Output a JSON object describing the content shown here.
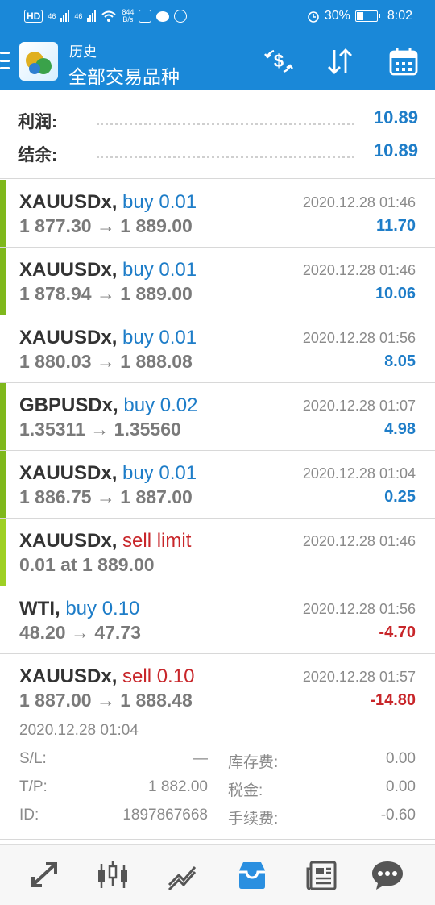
{
  "status_bar": {
    "speed": "844",
    "speed_unit": "B/s",
    "net1": "46",
    "net2": "46",
    "battery": "30%",
    "time": "8:02"
  },
  "header": {
    "subtitle": "历史",
    "title": "全部交易品种",
    "icons": [
      "menu-icon",
      "currency-exchange-icon",
      "sort-icon",
      "calendar-icon"
    ]
  },
  "summary": {
    "profit_label": "利润:",
    "profit_value": "10.89",
    "balance_label": "结余:",
    "balance_value": "10.89"
  },
  "trades": [
    {
      "symbol": "XAUUSDx,",
      "side": "buy 0.01",
      "side_type": "buy",
      "prices": "1 877.30 → 1 889.00",
      "time": "2020.12.28 01:46",
      "profit": "11.70",
      "profit_sign": "pos"
    },
    {
      "symbol": "XAUUSDx,",
      "side": "buy 0.01",
      "side_type": "buy",
      "prices": "1 878.94 → 1 889.00",
      "time": "2020.12.28 01:46",
      "profit": "10.06",
      "profit_sign": "pos"
    },
    {
      "symbol": "XAUUSDx,",
      "side": "buy 0.01",
      "side_type": "buy",
      "prices": "1 880.03 → 1 888.08",
      "time": "2020.12.28 01:56",
      "profit": "8.05",
      "profit_sign": "pos"
    },
    {
      "symbol": "GBPUSDx,",
      "side": "buy 0.02",
      "side_type": "buy",
      "prices": "1.35311 → 1.35560",
      "time": "2020.12.28 01:07",
      "profit": "4.98",
      "profit_sign": "pos"
    },
    {
      "symbol": "XAUUSDx,",
      "side": "buy 0.01",
      "side_type": "buy",
      "prices": "1 886.75 → 1 887.00",
      "time": "2020.12.28 01:04",
      "profit": "0.25",
      "profit_sign": "pos"
    },
    {
      "symbol": "XAUUSDx,",
      "side": "sell limit",
      "side_type": "sell",
      "prices": "0.01 at 1 889.00",
      "time": "2020.12.28 01:46",
      "profit": "",
      "profit_sign": "pos"
    },
    {
      "symbol": "WTI,",
      "side": "buy 0.10",
      "side_type": "buy",
      "prices": "48.20 → 47.73",
      "time": "2020.12.28 01:56",
      "profit": "-4.70",
      "profit_sign": "neg"
    },
    {
      "symbol": "XAUUSDx,",
      "side": "sell 0.10",
      "side_type": "sell",
      "prices": "1 887.00 → 1 888.48",
      "time": "2020.12.28 01:57",
      "profit": "-14.80",
      "profit_sign": "neg"
    }
  ],
  "expanded": {
    "open_time": "2020.12.28 01:04",
    "sl_label": "S/L:",
    "sl_value": "—",
    "tp_label": "T/P:",
    "tp_value": "1 882.00",
    "id_label": "ID:",
    "id_value": "1897867668",
    "swap_label": "库存费:",
    "swap_value": "0.00",
    "tax_label": "税金:",
    "tax_value": "0.00",
    "commission_label": "手续费:",
    "commission_value": "-0.60"
  },
  "tabs": [
    {
      "name": "tab-trade",
      "icon": "trade-arrows-icon",
      "active": false
    },
    {
      "name": "tab-chart",
      "icon": "candlestick-icon",
      "active": false
    },
    {
      "name": "tab-quotes",
      "icon": "trend-icon",
      "active": false
    },
    {
      "name": "tab-history",
      "icon": "inbox-icon",
      "active": true
    },
    {
      "name": "tab-news",
      "icon": "newspaper-icon",
      "active": false
    },
    {
      "name": "tab-chat",
      "icon": "chat-icon",
      "active": false
    }
  ],
  "colors": {
    "header_bg": "#1a88d8",
    "buy": "#1e7dc8",
    "sell": "#c8262a",
    "profit_pos": "#1e7dc8",
    "profit_neg": "#c8262a",
    "tab_active": "#2a8fe0",
    "tab_inactive": "#555555",
    "side_bar": "#7fb81c"
  }
}
